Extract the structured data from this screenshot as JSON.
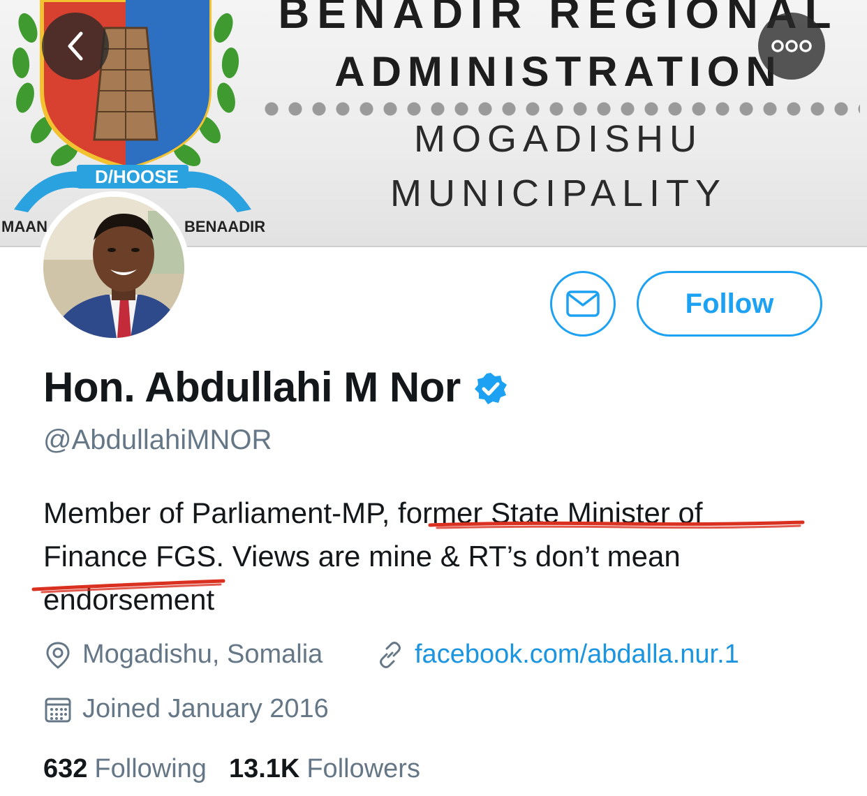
{
  "banner": {
    "line1": "BENADIR REGIONAL",
    "line2": "ADMINISTRATION",
    "line3": "MOGADISHU",
    "line4": "MUNICIPALITY",
    "crest_ribbon": "D/HOOSE",
    "crest_left": "MAAN",
    "crest_right": "BENAADIR"
  },
  "nav": {
    "back_icon": "chevron-left-icon",
    "more_icon": "more-dots-icon"
  },
  "actions": {
    "message_icon": "envelope-icon",
    "follow_label": "Follow"
  },
  "profile": {
    "display_name": "Hon. Abdullahi M Nor",
    "verified": true,
    "handle": "@AbdullahiMNOR",
    "bio_lines": [
      "Member of Parliament-MP, former State Minister of",
      "Finance FGS. Views are mine & RT’s don’t mean",
      "endorsement"
    ],
    "location": "Mogadishu, Somalia",
    "website": "facebook.com/abdalla.nur.1",
    "joined": "Joined January 2016"
  },
  "stats": {
    "following_count": "632",
    "following_label": "Following",
    "followers_count": "13.1K",
    "followers_label": "Followers"
  },
  "colors": {
    "accent": "#1da1f2",
    "link": "#1b95e0",
    "secondary_text": "#657786",
    "primary_text": "#14171a",
    "annotation_red": "#d9301f"
  }
}
